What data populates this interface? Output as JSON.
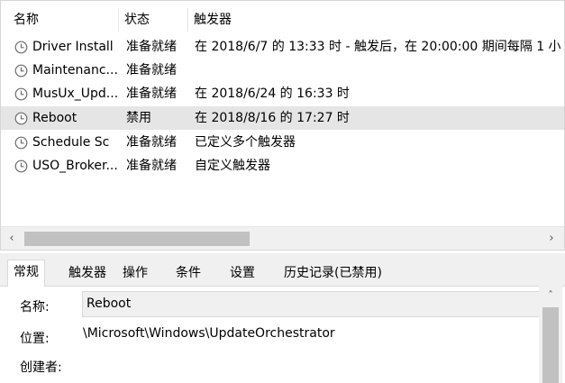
{
  "columns": {
    "name": "名称",
    "status": "状态",
    "trigger": "触发器"
  },
  "tasks": [
    {
      "name": "Driver Install",
      "status": "准备就绪",
      "trigger": "在 2018/6/7 的 13:33 时 - 触发后，在 20:00:00 期间每隔 1 小"
    },
    {
      "name": "Maintenanc...",
      "status": "准备就绪",
      "trigger": ""
    },
    {
      "name": "MusUx_Upd...",
      "status": "准备就绪",
      "trigger": "在 2018/6/24 的 16:33 时"
    },
    {
      "name": "Reboot",
      "status": "禁用",
      "trigger": "在 2018/8/16 的 17:27 时"
    },
    {
      "name": "Schedule Sc",
      "status": "准备就绪",
      "trigger": "已定义多个触发器"
    },
    {
      "name": "USO_Broker...",
      "status": "准备就绪",
      "trigger": "自定义触发器"
    }
  ],
  "selected_task_index": 3,
  "tabs": [
    "常规",
    "触发器",
    "操作",
    "条件",
    "设置",
    "历史记录(已禁用)"
  ],
  "active_tab": "常规",
  "general": {
    "name_label": "名称:",
    "name_value": "Reboot",
    "location_label": "位置:",
    "location_value": "\\Microsoft\\Windows\\UpdateOrchestrator",
    "author_label": "创建者:"
  },
  "icons": {
    "task": "clock-icon",
    "scroll_left": "chevron-left-icon",
    "scroll_right": "chevron-right-icon",
    "scroll_up": "chevron-up-icon"
  },
  "colors": {
    "selected_row": "#e5e5e5",
    "panel_bg": "#f0f0f0",
    "scroll_thumb": "#c1c1c1"
  }
}
